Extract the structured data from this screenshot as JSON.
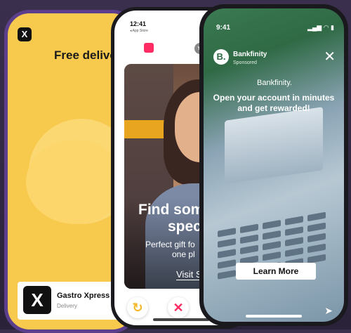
{
  "phone1": {
    "logo": "X",
    "headline": "Free deliver",
    "app_card": {
      "logo": "X",
      "name": "Gastro Xpress",
      "category": "Delivery"
    }
  },
  "phone2": {
    "time": "12:41",
    "back_label": "◂ App Store",
    "overlay": {
      "line1": "Find som",
      "line2": "spec",
      "sub1": "Perfect gift fo",
      "sub2": "one pl",
      "link": "Visit S"
    },
    "actions": [
      {
        "icon": "rewind-icon",
        "glyph": "↻",
        "color": "#f5b82e"
      },
      {
        "icon": "nope-icon",
        "glyph": "✕",
        "color": "#fd2d63"
      },
      {
        "icon": "super-like-icon",
        "glyph": "★",
        "color": "#fd2d63"
      }
    ]
  },
  "phone3": {
    "time": "9:41",
    "status_icons": "▂▄▆ ◠ ▮",
    "avatar_letter": "B.",
    "brand": "Bankfinity",
    "sponsored": "Sponsored",
    "brand_logo": "Bankfinity.",
    "promo_line1": "Open your account in minutes",
    "promo_line2": "and get rewarded!",
    "cta": "Learn More"
  }
}
